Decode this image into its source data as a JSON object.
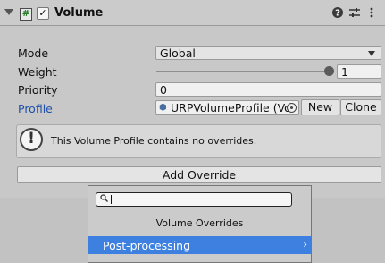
{
  "component": {
    "title": "Volume",
    "enabled_check": "✓"
  },
  "fields": {
    "mode_label": "Mode",
    "mode_value": "Global",
    "weight_label": "Weight",
    "weight_value": "1",
    "priority_label": "Priority",
    "priority_value": "0",
    "profile_label": "Profile",
    "profile_value": "URPVolumeProfile (Vol",
    "new_button": "New",
    "clone_button": "Clone"
  },
  "help": {
    "message": "This Volume Profile contains no overrides."
  },
  "add_override": "Add Override",
  "popup": {
    "search_value": "",
    "title": "Volume Overrides",
    "items": [
      {
        "label": "Post-processing"
      }
    ]
  },
  "colors": {
    "profile_label": "#1f4fa8",
    "selection": "#3d80df"
  }
}
